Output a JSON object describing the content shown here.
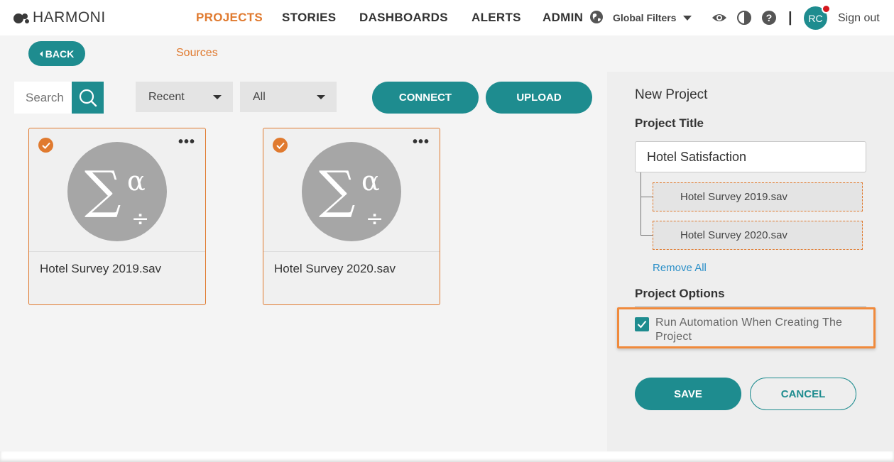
{
  "brand": {
    "logo_text": "HARMONI"
  },
  "nav": {
    "items": [
      {
        "label": "PROJECTS",
        "active": true
      },
      {
        "label": "STORIES",
        "active": false
      },
      {
        "label": "DASHBOARDS",
        "active": false
      },
      {
        "label": "ALERTS",
        "active": false
      },
      {
        "label": "ADMIN",
        "active": false
      }
    ],
    "global_filters": "Global Filters",
    "separator": "|",
    "avatar_initials": "RC",
    "sign_out": "Sign out",
    "icons": [
      "globe-icon",
      "eye-icon",
      "contrast-icon",
      "help-icon"
    ]
  },
  "subheader": {
    "back_label": "BACK",
    "breadcrumb": "Sources"
  },
  "toolbar": {
    "search_placeholder": "Search",
    "sort_value": "Recent",
    "filter_value": "All",
    "connect_label": "CONNECT",
    "upload_label": "UPLOAD"
  },
  "cards": [
    {
      "title": "Hotel Survey 2019.sav",
      "selected": true,
      "menu": "•••"
    },
    {
      "title": "Hotel Survey 2020.sav",
      "selected": true,
      "menu": "•••"
    }
  ],
  "panel": {
    "heading": "New Project",
    "project_title_label": "Project Title",
    "project_title_value": "Hotel Satisfaction",
    "sources": [
      "Hotel Survey 2019.sav",
      "Hotel Survey 2020.sav"
    ],
    "remove_all": "Remove All",
    "options_label": "Project Options",
    "automation_label": "Run Automation When Creating The Project",
    "automation_checked": true,
    "save_label": "SAVE",
    "cancel_label": "CANCEL"
  },
  "colors": {
    "accent_teal": "#1e8c8f",
    "accent_orange": "#e07a2f",
    "link_blue": "#2a8fc8",
    "notification_red": "#d4171e"
  }
}
